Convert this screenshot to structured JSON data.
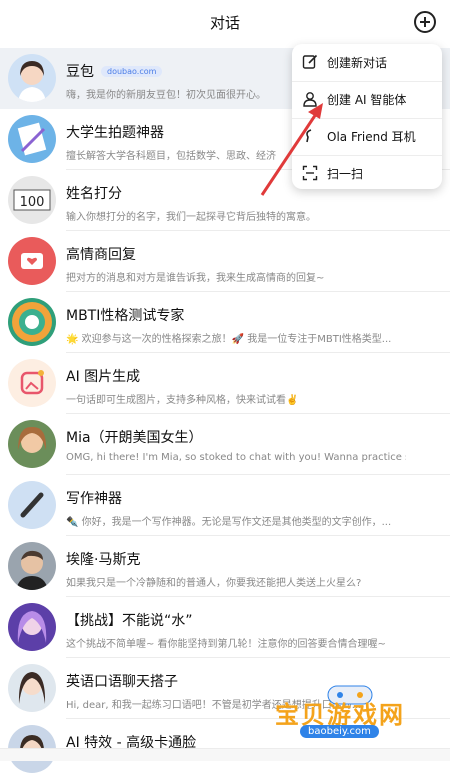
{
  "header": {
    "title": "对话"
  },
  "menu": {
    "items": [
      {
        "label": "创建新对话",
        "icon": "edit-icon"
      },
      {
        "label": "创建 AI 智能体",
        "icon": "person-icon"
      },
      {
        "label": "Ola Friend 耳机",
        "icon": "earbuds-icon"
      },
      {
        "label": "扫一扫",
        "icon": "scan-icon"
      }
    ]
  },
  "chats": [
    {
      "name": "豆包",
      "badge": "doubao.com",
      "preview": "嗨，我是你的新朋友豆包！初次见面很开心。"
    },
    {
      "name": "大学生拍题神器",
      "preview": "擅长解答大学各科题目，包括数学、思政、经济"
    },
    {
      "name": "姓名打分",
      "preview": "输入你想打分的名字，我们一起探寻它背后独特的寓意。"
    },
    {
      "name": "高情商回复",
      "preview": "把对方的消息和对方是谁告诉我，我来生成高情商的回复~"
    },
    {
      "name": "MBTI性格测试专家",
      "preview": "🌟 欢迎参与这一次的性格探索之旅！🚀 我是一位专注于MBTI性格类型..."
    },
    {
      "name": "AI 图片生成",
      "preview": "一句话即可生成图片，支持多种风格，快来试试看✌️"
    },
    {
      "name": "Mia（开朗美国女生）",
      "preview": "OMG, hi there! I'm Mia, so stoked to chat with you! Wanna practice some..."
    },
    {
      "name": "写作神器",
      "preview": "✒️ 你好，我是一个写作神器。无论是写作文还是其他类型的文字创作，..."
    },
    {
      "name": "埃隆·马斯克",
      "preview": "如果我只是一个冷静随和的普通人，你要我还能把人类送上火星么?"
    },
    {
      "name": "【挑战】不能说“水”",
      "preview": "这个挑战不简单喔~ 看你能坚持到第几轮！注意你的回答要合情合理喔~"
    },
    {
      "name": "英语口语聊天搭子",
      "preview": "Hi, dear, 和我一起练习口语吧！不管是初学者还是想提升口语的..."
    },
    {
      "name": "AI 特效 - 高级卡通脸",
      "preview": ""
    }
  ],
  "watermark": {
    "text": "宝贝游戏网",
    "url": "baobeiy.com"
  }
}
